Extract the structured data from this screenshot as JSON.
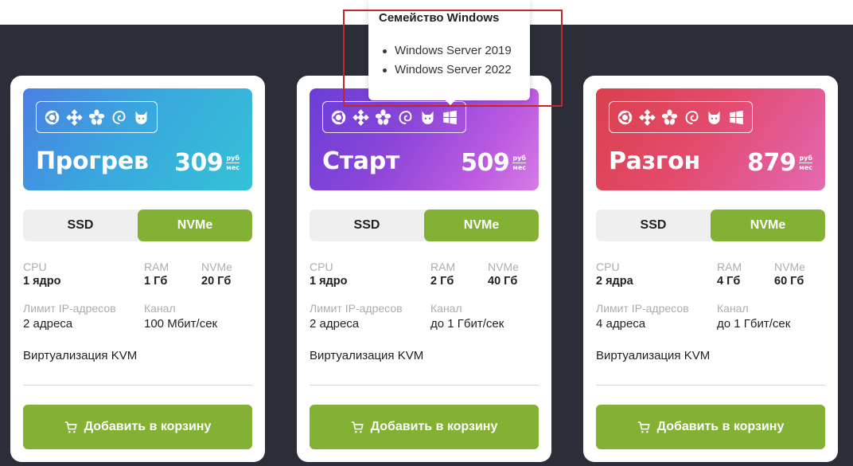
{
  "tooltip": {
    "title": "Семейство Windows",
    "items": [
      "Windows Server 2019",
      "Windows Server 2022"
    ]
  },
  "labels": {
    "cpu": "CPU",
    "ram": "RAM",
    "nvme": "NVMe",
    "ip_limit": "Лимит IP-адресов",
    "channel": "Канал",
    "currency_top": "руб",
    "currency_bottom": "мес",
    "add_to_cart": "Добавить в корзину"
  },
  "colors": {
    "accent_green": "#82b133",
    "background_dark": "#2b2e38",
    "highlight_red": "#c0282d"
  },
  "os_icons": [
    "ubuntu-icon",
    "centos-icon",
    "freebsd-icon",
    "debian-icon",
    "fedora-icon",
    "windows-icon"
  ],
  "plans": [
    {
      "name": "Прогрев",
      "price": "309",
      "color": "blue",
      "os": [
        "ubuntu-icon",
        "centos-icon",
        "freebsd-icon",
        "debian-icon",
        "fedora-icon"
      ],
      "disk_options": [
        "SSD",
        "NVMe"
      ],
      "disk_selected": "NVMe",
      "cpu": "1 ядро",
      "ram": "1 Гб",
      "nvme": "20 Гб",
      "ip_limit": "2 адреса",
      "channel": "100 Мбит/сек",
      "virtualization": "Виртуализация KVM"
    },
    {
      "name": "Старт",
      "price": "509",
      "color": "purple",
      "os": [
        "ubuntu-icon",
        "centos-icon",
        "freebsd-icon",
        "debian-icon",
        "fedora-icon",
        "windows-icon"
      ],
      "disk_options": [
        "SSD",
        "NVMe"
      ],
      "disk_selected": "NVMe",
      "cpu": "1 ядро",
      "ram": "2 Гб",
      "nvme": "40 Гб",
      "ip_limit": "2 адреса",
      "channel": "до 1 Гбит/сек",
      "virtualization": "Виртуализация KVM"
    },
    {
      "name": "Разгон",
      "price": "879",
      "color": "red",
      "os": [
        "ubuntu-icon",
        "centos-icon",
        "freebsd-icon",
        "debian-icon",
        "fedora-icon",
        "windows-icon"
      ],
      "disk_options": [
        "SSD",
        "NVMe"
      ],
      "disk_selected": "NVMe",
      "cpu": "2 ядра",
      "ram": "4 Гб",
      "nvme": "60 Гб",
      "ip_limit": "4 адреса",
      "channel": "до 1 Гбит/сек",
      "virtualization": "Виртуализация KVM"
    }
  ]
}
